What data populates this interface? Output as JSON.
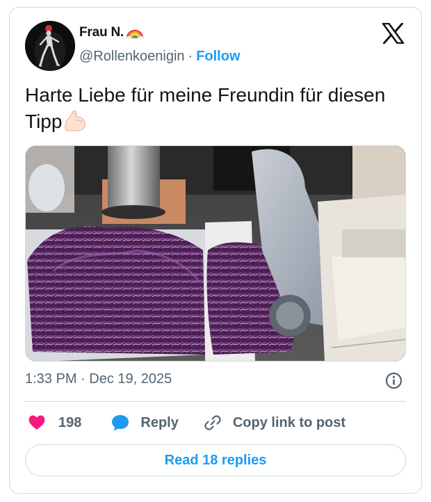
{
  "author": {
    "display_name": "Frau N.",
    "name_emoji": "rainbow-icon",
    "handle": "@Rollenkoenigin",
    "separator": "·",
    "follow_label": "Follow"
  },
  "tweet": {
    "text": "Harte Liebe für meine Freundin für diesen Tipp",
    "trailing_emoji": "flexed-biceps-icon",
    "media_description_icons": [
      "red-cabbage",
      "meat-slicer"
    ],
    "timestamp": "1:33 PM · Dec 19, 2025"
  },
  "actions": {
    "like_count": "198",
    "reply_label": "Reply",
    "copy_label": "Copy link to post"
  },
  "footer": {
    "read_replies_label": "Read 18 replies"
  },
  "colors": {
    "accent": "#1d9bf0",
    "heart": "#f91880",
    "secondary_text": "#536471",
    "border": "#cfd9de"
  }
}
